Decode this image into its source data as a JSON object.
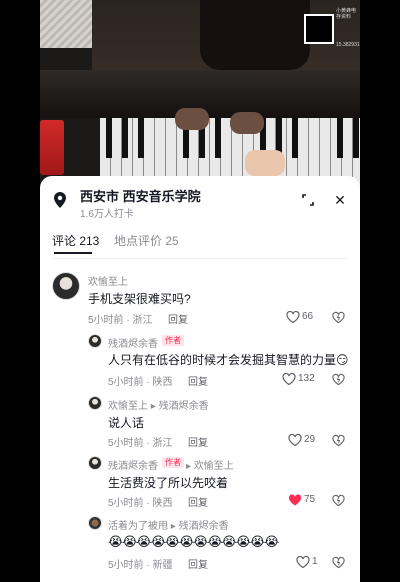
{
  "watermark": {
    "line1": "小黄蜂电存资料",
    "line2": "15.382931"
  },
  "location": {
    "title": "西安市  西安音乐学院",
    "checkins": "1.6万人打卡"
  },
  "tabs": [
    {
      "label": "评论 213",
      "active": true
    },
    {
      "label": "地点评价 25",
      "active": false
    }
  ],
  "reply_label": "回复",
  "comments": [
    {
      "name": "欢愉至上",
      "text": "手机支架很难买吗?",
      "time": "5小时前 · 浙江",
      "likes": "66",
      "liked": false
    },
    {
      "name": "残酒烬余香",
      "badge": "作者",
      "text": "人只有在低谷的时候才会发掘其智慧的力量😏",
      "time": "5小时前 · 陕西",
      "likes": "132",
      "liked": false
    },
    {
      "name": "欢愉至上",
      "reply_to": "残酒烬余香",
      "text": "说人话",
      "time": "5小时前 · 浙江",
      "likes": "29",
      "liked": false
    },
    {
      "name": "残酒烬余香",
      "badge": "作者",
      "reply_to": "欢愉至上",
      "text": "生活费没了所以先咬着",
      "time": "5小时前 · 陕西",
      "likes": "75",
      "liked": true
    },
    {
      "name": "活着为了被甩",
      "reply_to": "残酒烬余香",
      "text": "😭😭😭😭😭😭😭😭😭😭😭😭",
      "time": "5小时前 · 新疆",
      "likes": "1",
      "liked": false
    }
  ],
  "colors": {
    "like_active": "#fe2c55",
    "text": "#161823",
    "muted": "#8a8b91"
  }
}
